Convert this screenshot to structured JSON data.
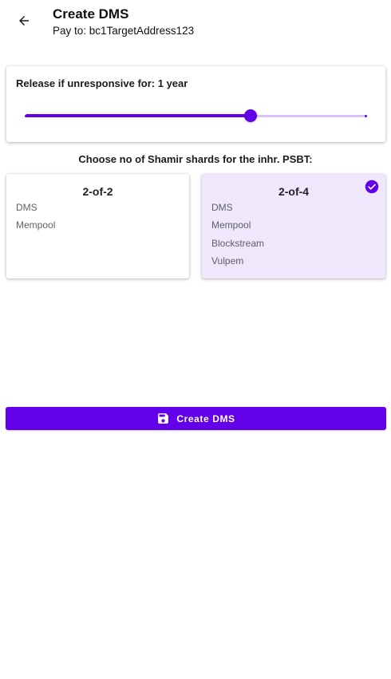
{
  "appbar": {
    "title": "Create DMS",
    "subtitle": "Pay to: bc1TargetAddress123",
    "back_icon": "arrow-left-icon"
  },
  "release_slider": {
    "label": "Release if unresponsive for: 1 year",
    "value_fraction": 0.66,
    "accent_color": "#6200ea",
    "inactive_color": "#d6c4f7"
  },
  "shards": {
    "prompt": "Choose no of Shamir shards for the inhr. PSBT:",
    "options": [
      {
        "title": "2-of-2",
        "items": [
          "DMS",
          "Mempool"
        ],
        "selected": false
      },
      {
        "title": "2-of-4",
        "items": [
          "DMS",
          "Mempool",
          "Blockstream",
          "Vulpem"
        ],
        "selected": true,
        "selected_icon": "check-circle-icon"
      }
    ],
    "selected_bg": "#efe7fc"
  },
  "create_button": {
    "label": "Create DMS",
    "icon": "save-icon",
    "color": "#6200ea"
  }
}
